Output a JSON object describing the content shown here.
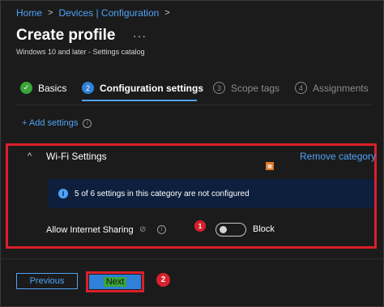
{
  "breadcrumb": {
    "home": "Home",
    "separator": ">",
    "devices": "Devices | Configuration",
    "trail": ">"
  },
  "header": {
    "title": "Create profile",
    "more": "···",
    "subtitle": "Windows 10 and later - Settings catalog"
  },
  "steps": [
    {
      "num": "✓",
      "label": "Basics",
      "state": "completed"
    },
    {
      "num": "2",
      "label": "Configuration settings",
      "state": "active"
    },
    {
      "num": "3",
      "label": "Scope tags",
      "state": "inactive"
    },
    {
      "num": "4",
      "label": "Assignments",
      "state": "inactive"
    }
  ],
  "add_settings": {
    "label": "+ Add settings",
    "info": "i"
  },
  "category": {
    "chevron": "^",
    "title": "Wi-Fi Settings",
    "remove": "Remove category",
    "banner": {
      "icon": "i",
      "text": "5 of 6 settings in this category are not configured"
    },
    "setting": {
      "label": "Allow Internet Sharing",
      "sync_icon": "⊘",
      "help_icon": "i",
      "toggle_on": false,
      "state_text": "Block"
    }
  },
  "annotations": {
    "badge1": "1",
    "badge2": "2",
    "tiny_badge": "▦"
  },
  "footer": {
    "previous": "Previous",
    "next": "Next"
  },
  "colors": {
    "accent": "#4fa3f7",
    "annotation_red": "#d9202b",
    "success": "#3aa63a",
    "background": "#1b1b1b",
    "banner": "#0d1f3c"
  }
}
